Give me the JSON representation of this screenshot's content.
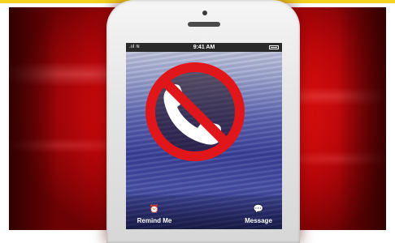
{
  "status_bar": {
    "signal": ".ııl ≋",
    "time": "9:41 AM"
  },
  "actions": {
    "remind_me": "Remind Me",
    "message": "Message",
    "remind_glyph": "⏰",
    "message_glyph": "💬"
  },
  "icons": {
    "no_call": "no-phone-call-icon",
    "alarm": "alarm-clock-icon",
    "message": "speech-bubble-icon"
  },
  "colors": {
    "background_red": "#e5110e",
    "prohibition_red": "#e0161a",
    "phone_white": "#f0f0f0"
  }
}
